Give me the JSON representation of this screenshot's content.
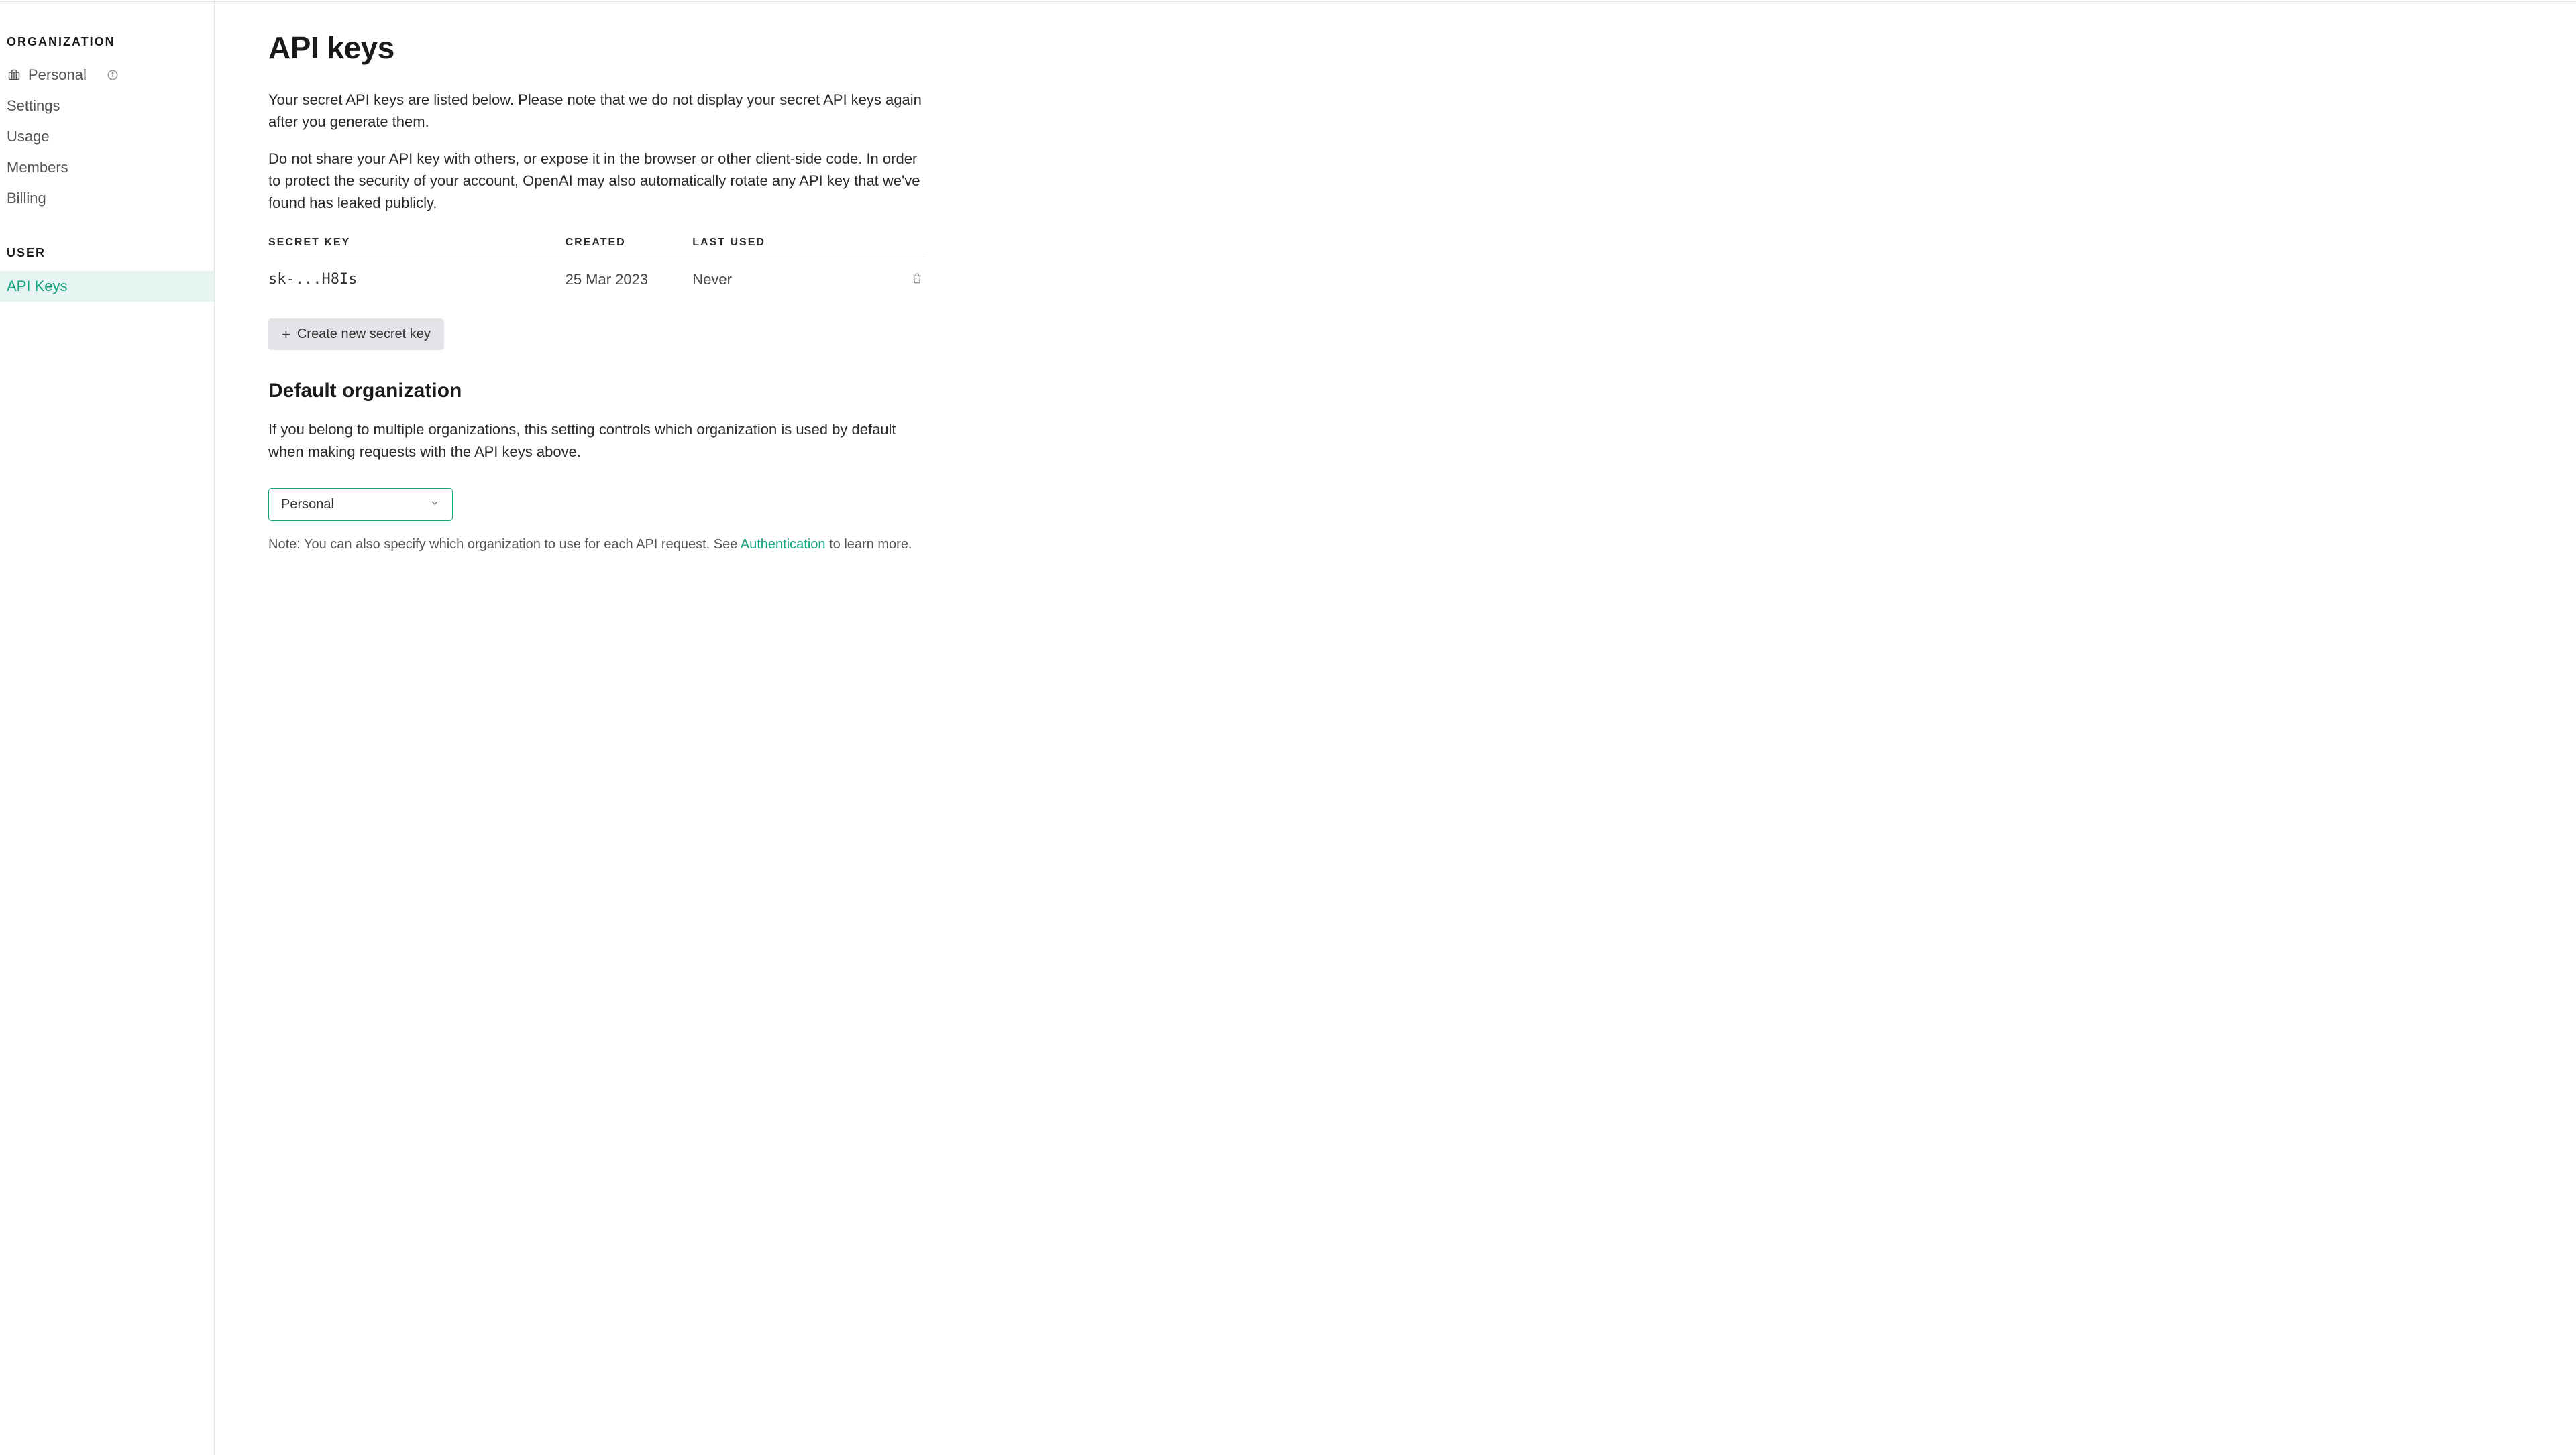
{
  "sidebar": {
    "orgSectionTitle": "ORGANIZATION",
    "userSectionTitle": "USER",
    "orgName": "Personal",
    "items": {
      "settings": "Settings",
      "usage": "Usage",
      "members": "Members",
      "billing": "Billing",
      "apiKeys": "API Keys"
    }
  },
  "main": {
    "title": "API keys",
    "para1": "Your secret API keys are listed below. Please note that we do not display your secret API keys again after you generate them.",
    "para2": "Do not share your API key with others, or expose it in the browser or other client-side code. In order to protect the security of your account, OpenAI may also automatically rotate any API key that we've found has leaked publicly.",
    "table": {
      "headers": {
        "secretKey": "SECRET KEY",
        "created": "CREATED",
        "lastUsed": "LAST USED"
      },
      "rows": [
        {
          "key": "sk-...H8Is",
          "created": "25 Mar 2023",
          "lastUsed": "Never"
        }
      ]
    },
    "createKeyLabel": "Create new secret key",
    "defaultOrg": {
      "heading": "Default organization",
      "description": "If you belong to multiple organizations, this setting controls which organization is used by default when making requests with the API keys above.",
      "selected": "Personal",
      "notePrefix": "Note: You can also specify which organization to use for each API request. See ",
      "noteLink": "Authentication",
      "noteSuffix": " to learn more."
    }
  },
  "colors": {
    "accent": "#10a37f"
  }
}
